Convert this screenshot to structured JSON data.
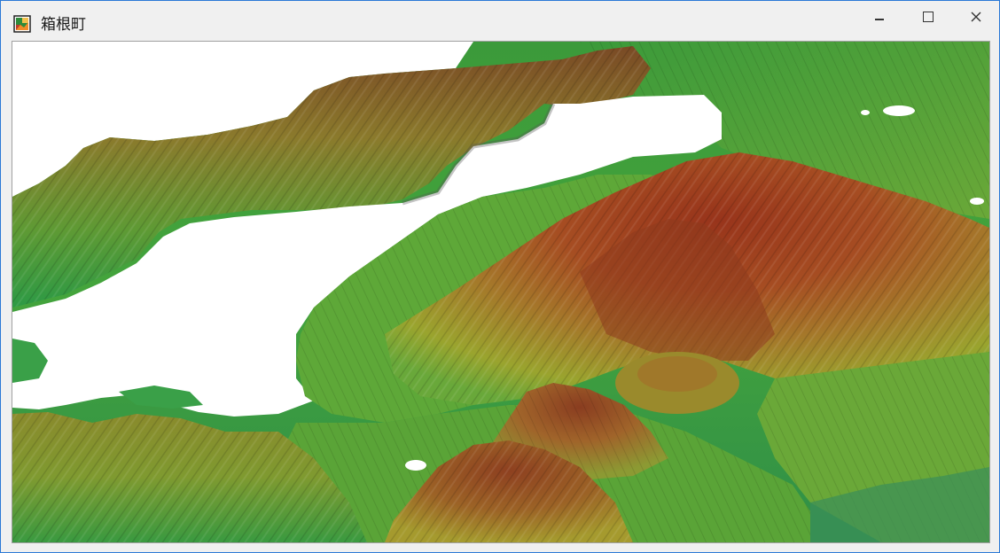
{
  "window": {
    "title": "箱根町",
    "app_icon": "map-app-icon",
    "controls": [
      "minimize-icon",
      "maximize-icon",
      "close-icon"
    ]
  },
  "viewport": {
    "content": "3d-terrain-render",
    "colors": {
      "low": "#1fa84a",
      "mid": "#b9a426",
      "high": "#9a3b1c",
      "lake": "#ffffff"
    }
  }
}
